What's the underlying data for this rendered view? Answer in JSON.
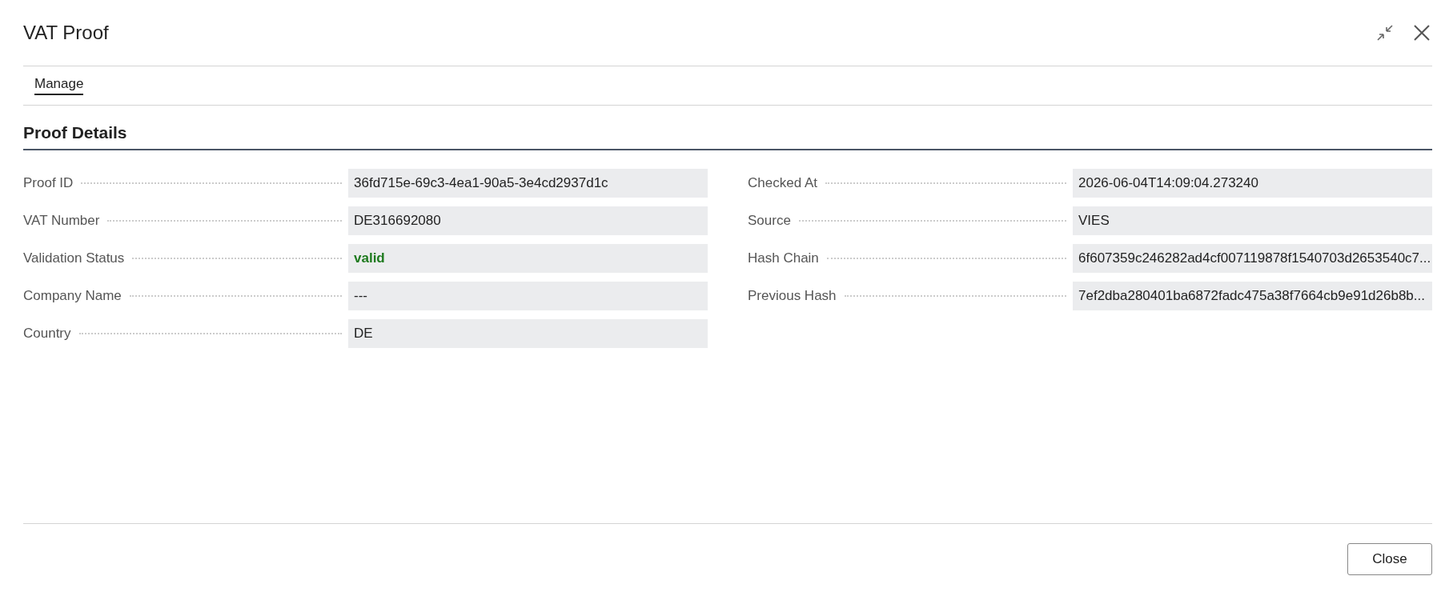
{
  "window": {
    "title": "VAT Proof"
  },
  "tabs": [
    {
      "label": "Manage",
      "selected": true
    }
  ],
  "section": {
    "title": "Proof Details"
  },
  "columns": [
    {
      "fields": [
        {
          "label": "Proof ID",
          "value": "36fd715e-69c3-4ea1-90a5-3e4cd2937d1c",
          "kind": "text"
        },
        {
          "label": "VAT Number",
          "value": "DE316692080",
          "kind": "text"
        },
        {
          "label": "Validation Status",
          "value": "valid",
          "kind": "status"
        },
        {
          "label": "Company Name",
          "value": "---",
          "kind": "text"
        },
        {
          "label": "Country",
          "value": "DE",
          "kind": "text"
        }
      ]
    },
    {
      "fields": [
        {
          "label": "Checked At",
          "value": "2026-06-04T14:09:04.273240",
          "kind": "text"
        },
        {
          "label": "Source",
          "value": "VIES",
          "kind": "text"
        },
        {
          "label": "Hash Chain",
          "value": "6f607359c246282ad4cf007119878f1540703d2653540c7...",
          "kind": "text"
        },
        {
          "label": "Previous Hash",
          "value": "7ef2dba280401ba6872fadc475a38f7664cb9e91d26b8b...",
          "kind": "text"
        }
      ]
    }
  ],
  "buttons": [
    {
      "label": "Close"
    }
  ]
}
